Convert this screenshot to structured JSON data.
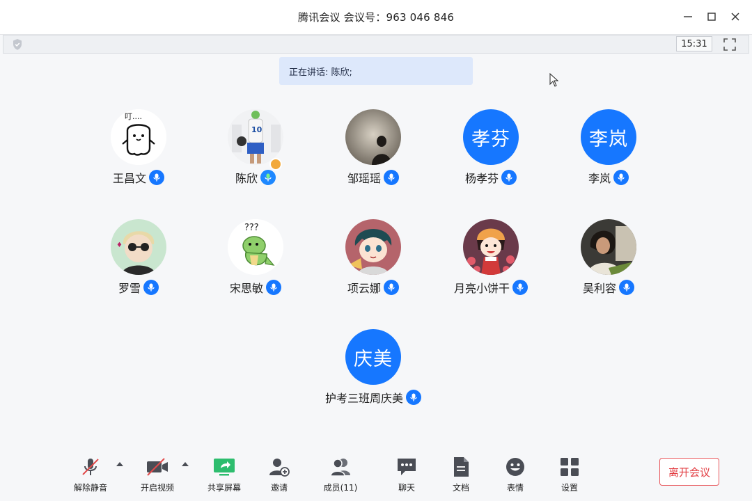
{
  "window": {
    "title": "腾讯会议 会议号：963 046 846",
    "clock": "15:31"
  },
  "speaking": "正在讲话: 陈欣;",
  "participants": [
    {
      "name": "王昌文",
      "avatar": "cartoon-dumpling-icon",
      "avatar_caption": "叮...."
    },
    {
      "name": "陈欣",
      "avatar": "photo-basketball-player",
      "host": true
    },
    {
      "name": "邹瑶瑶",
      "avatar": "photo-silhouette"
    },
    {
      "name": "杨孝芬",
      "avatar_text": "孝芬"
    },
    {
      "name": "李岚",
      "avatar_text": "李岚"
    },
    {
      "name": "罗雪",
      "avatar": "cartoon-sunglasses-icon"
    },
    {
      "name": "宋思敏",
      "avatar": "cartoon-dinosaur-icon",
      "avatar_caption": "???"
    },
    {
      "name": "项云娜",
      "avatar": "cartoon-boy-icon"
    },
    {
      "name": "月亮小饼干",
      "avatar": "cartoon-girl-icon"
    },
    {
      "name": "吴利容",
      "avatar": "photo-person"
    },
    {
      "name": "护考三班周庆美",
      "avatar_text": "庆美"
    }
  ],
  "toolbar": {
    "mute": "解除静音",
    "video": "开启视频",
    "share": "共享屏幕",
    "invite": "邀请",
    "members": "成员(11)",
    "chat": "聊天",
    "docs": "文档",
    "emoji": "表情",
    "settings": "设置",
    "leave": "离开会议"
  },
  "colors": {
    "accent": "#1677ff",
    "leave": "#e23c41",
    "share": "#2dbd6e",
    "muted_slash": "#e24a4a"
  }
}
